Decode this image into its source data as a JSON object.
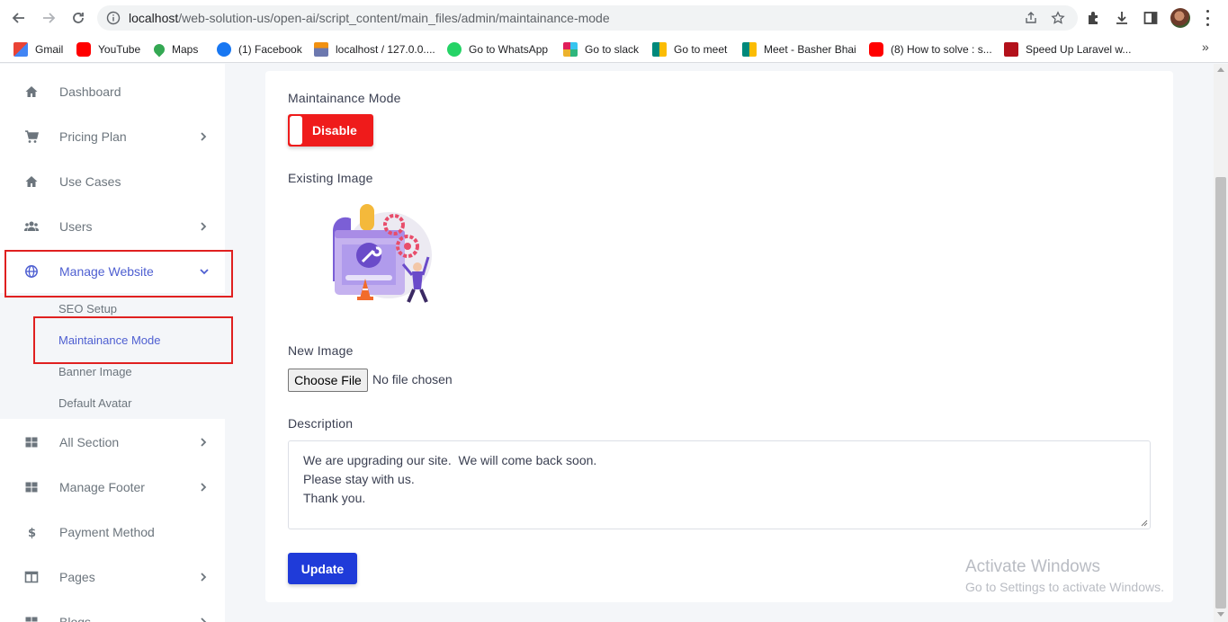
{
  "browser": {
    "url_host": "localhost",
    "url_path": "/web-solution-us/open-ai/script_content/main_files/admin/maintainance-mode",
    "bookmarks": [
      {
        "label": "Gmail",
        "icon": "gmail-icon",
        "color": "#ea4335"
      },
      {
        "label": "YouTube",
        "icon": "youtube-icon",
        "color": "#ff0000"
      },
      {
        "label": "Maps",
        "icon": "maps-icon",
        "color": "#34a853"
      },
      {
        "label": "(1) Facebook",
        "icon": "facebook-icon",
        "color": "#1877f2"
      },
      {
        "label": "localhost / 127.0.0....",
        "icon": "phpmyadmin-icon",
        "color": "#f29111"
      },
      {
        "label": "Go to WhatsApp",
        "icon": "whatsapp-icon",
        "color": "#25d366"
      },
      {
        "label": "Go to slack",
        "icon": "slack-icon",
        "color": "#e01e5a"
      },
      {
        "label": "Go to meet",
        "icon": "meet-icon",
        "color": "#00897b"
      },
      {
        "label": "Meet - Basher Bhai",
        "icon": "meet-icon",
        "color": "#00897b"
      },
      {
        "label": "(8) How to solve : s...",
        "icon": "youtube-icon",
        "color": "#ff0000"
      },
      {
        "label": "Speed Up Laravel w...",
        "icon": "laravel-icon",
        "color": "#b3111b"
      }
    ],
    "more_symbol": "»"
  },
  "sidebar": {
    "items": [
      {
        "label": "Dashboard",
        "icon": "home-icon"
      },
      {
        "label": "Pricing Plan",
        "icon": "cart-icon"
      },
      {
        "label": "Use Cases",
        "icon": "home-icon"
      },
      {
        "label": "Users",
        "icon": "users-icon"
      },
      {
        "label": "Manage Website",
        "icon": "globe-icon"
      },
      {
        "label": "All Section",
        "icon": "grid-icon"
      },
      {
        "label": "Manage Footer",
        "icon": "grid-icon"
      },
      {
        "label": "Payment Method",
        "icon": "dollar-icon"
      },
      {
        "label": "Pages",
        "icon": "columns-icon"
      },
      {
        "label": "Blogs",
        "icon": "grid-icon"
      }
    ],
    "submenu": [
      {
        "label": "SEO Setup"
      },
      {
        "label": "Maintainance Mode"
      },
      {
        "label": "Banner Image"
      },
      {
        "label": "Default Avatar"
      }
    ]
  },
  "form": {
    "mode_label": "Maintainance Mode",
    "toggle_label": "Disable",
    "existing_image_label": "Existing Image",
    "new_image_label": "New Image",
    "choose_file": "Choose File",
    "no_file": "No file chosen",
    "description_label": "Description",
    "description_lines": [
      "We are upgrading our site.  We will come back soon.",
      "Please stay with us.",
      "Thank you."
    ],
    "update_label": "Update"
  },
  "watermark": {
    "title": "Activate Windows",
    "subtitle": "Go to Settings to activate Windows."
  },
  "colors": {
    "accent": "#4e5fd1",
    "toggle_off": "#ef1b1b",
    "button_primary": "#1f3bd9",
    "highlight_box": "#e02020"
  }
}
